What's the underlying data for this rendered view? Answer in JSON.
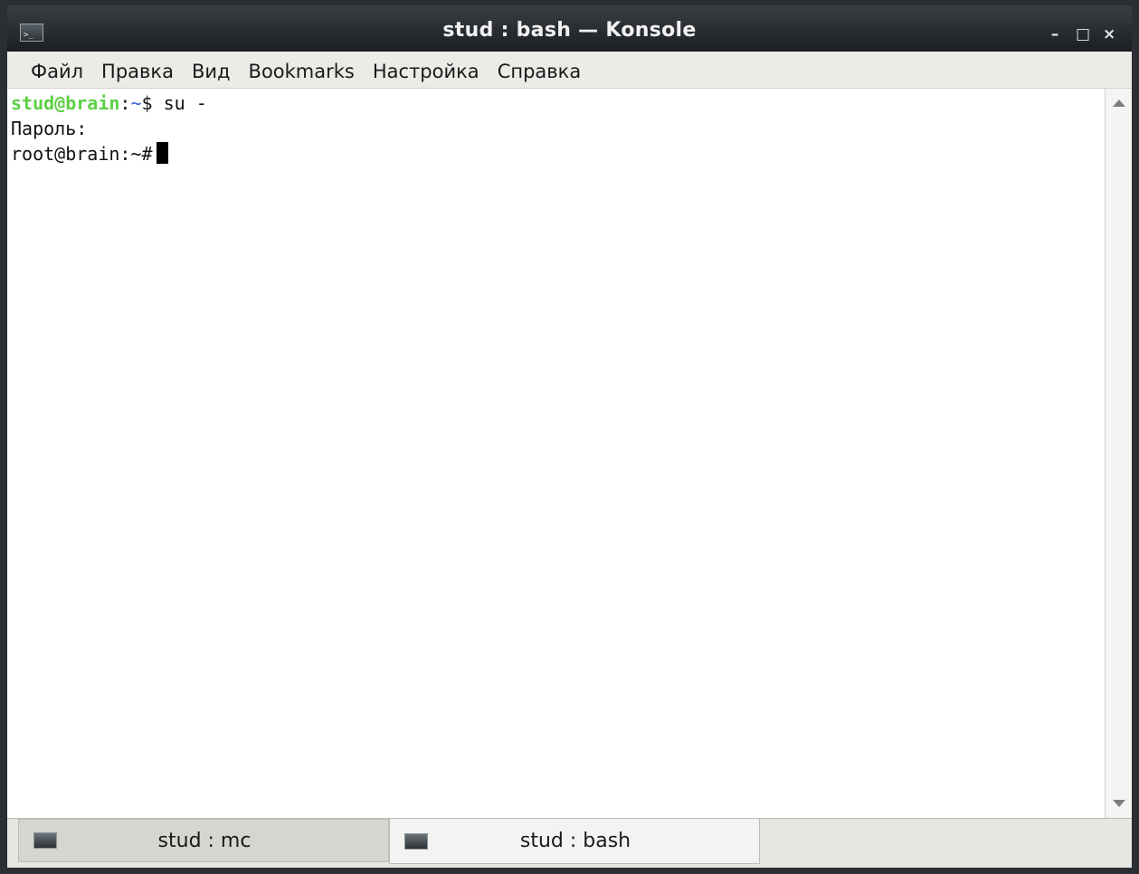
{
  "window": {
    "title": "stud : bash — Konsole",
    "minimize_label": "–",
    "maximize_label": "□",
    "close_label": "×"
  },
  "menu": {
    "items": [
      "Файл",
      "Правка",
      "Вид",
      "Bookmarks",
      "Настройка",
      "Справка"
    ]
  },
  "terminal": {
    "line1_user": "stud@brain",
    "line1_colon": ":",
    "line1_path": "~",
    "line1_rest": "$ su -",
    "line2": "Пароль:",
    "line3": "root@brain:~#"
  },
  "tabs": [
    {
      "label": "stud : mc",
      "active": false
    },
    {
      "label": "stud : bash",
      "active": true
    }
  ],
  "icons": {
    "app": "terminal-icon",
    "tab": "terminal-icon"
  },
  "colors": {
    "prompt_user": "#5cd045",
    "prompt_path": "#3c5ed6"
  }
}
